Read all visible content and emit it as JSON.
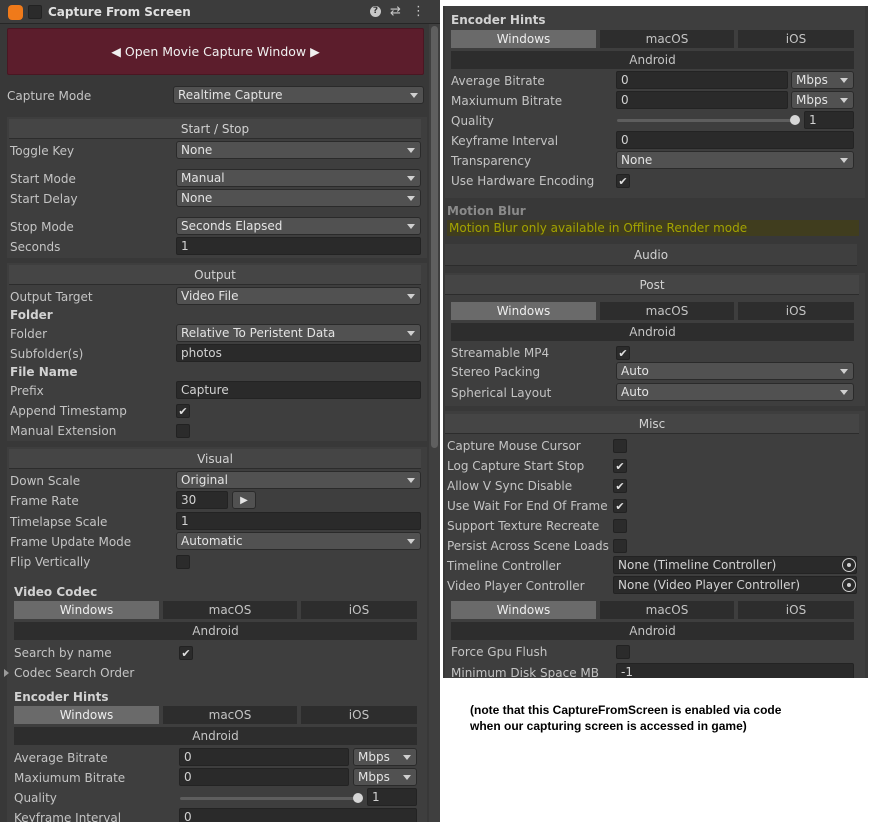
{
  "header": {
    "title": "Capture From Screen",
    "help_icon": "help-icon",
    "settings_icon": "sliders-icon",
    "more_icon": "kebab-icon"
  },
  "colors": {
    "banner": "#5c1d2c",
    "panel": "#383838",
    "active_tab": "#6a6a6a",
    "motion_blur_text": "#a3a300"
  },
  "banner": {
    "label": "◀ Open Movie Capture Window ▶"
  },
  "capture_mode": {
    "label": "Capture Mode",
    "value": "Realtime Capture"
  },
  "start_stop": {
    "header": "Start / Stop",
    "toggle_key": {
      "label": "Toggle Key",
      "value": "None"
    },
    "start_mode": {
      "label": "Start Mode",
      "value": "Manual"
    },
    "start_delay": {
      "label": "Start Delay",
      "value": "None"
    },
    "stop_mode": {
      "label": "Stop Mode",
      "value": "Seconds Elapsed"
    },
    "seconds": {
      "label": "Seconds",
      "value": "1"
    }
  },
  "output": {
    "header": "Output",
    "output_target": {
      "label": "Output Target",
      "value": "Video File"
    },
    "folder_heading": "Folder",
    "folder": {
      "label": "Folder",
      "value": "Relative To Peristent Data"
    },
    "subfolder": {
      "label": "Subfolder(s)",
      "value": "photos"
    },
    "file_name_heading": "File Name",
    "prefix": {
      "label": "Prefix",
      "value": "Capture"
    },
    "append_timestamp": {
      "label": "Append Timestamp",
      "checked": "✔"
    },
    "manual_extension": {
      "label": "Manual Extension"
    }
  },
  "visual": {
    "header": "Visual",
    "down_scale": {
      "label": "Down Scale",
      "value": "Original"
    },
    "frame_rate": {
      "label": "Frame Rate",
      "value": "30",
      "play": "▶"
    },
    "timelapse_scale": {
      "label": "Timelapse Scale",
      "value": "1"
    },
    "frame_update_mode": {
      "label": "Frame Update Mode",
      "value": "Automatic"
    },
    "flip_vertically": {
      "label": "Flip Vertically"
    }
  },
  "platform_tabs": {
    "windows": "Windows",
    "macos": "macOS",
    "ios": "iOS",
    "android": "Android"
  },
  "video_codec": {
    "heading": "Video Codec",
    "search_by_name": {
      "label": "Search by name",
      "checked": "✔"
    },
    "codec_search_order": "Codec Search Order"
  },
  "encoder_hints": {
    "heading": "Encoder Hints",
    "average_bitrate": {
      "label": "Average Bitrate",
      "value": "0",
      "unit": "Mbps"
    },
    "maximum_bitrate": {
      "label": "Maxiumum Bitrate",
      "value": "0",
      "unit": "Mbps"
    },
    "quality": {
      "label": "Quality",
      "value": "1",
      "level": 1.0
    },
    "keyframe_interval": {
      "label": "Keyframe Interval",
      "value": "0"
    },
    "transparency": {
      "label": "Transparency",
      "value": "None"
    },
    "use_hardware_encoding": {
      "label": "Use Hardware Encoding",
      "checked": "✔"
    }
  },
  "motion_blur": {
    "heading": "Motion Blur",
    "message": "Motion Blur only available in Offline Render mode"
  },
  "audio": {
    "header": "Audio"
  },
  "post": {
    "header": "Post",
    "streamable_mp4": {
      "label": "Streamable MP4",
      "checked": "✔"
    },
    "stereo_packing": {
      "label": "Stereo Packing",
      "value": "Auto"
    },
    "spherical_layout": {
      "label": "Spherical Layout",
      "value": "Auto"
    }
  },
  "misc": {
    "header": "Misc",
    "capture_mouse_cursor": {
      "label": "Capture Mouse Cursor"
    },
    "log_capture_start_stop": {
      "label": "Log Capture Start Stop",
      "checked": "✔"
    },
    "allow_vsync_disable": {
      "label": "Allow V Sync Disable",
      "checked": "✔"
    },
    "use_wait_for_end_of_frame": {
      "label": "Use Wait For End Of Frame",
      "checked": "✔"
    },
    "support_texture_recreate": {
      "label": "Support Texture Recreate"
    },
    "persist_across_scene_loads": {
      "label": "Persist Across Scene Loads"
    },
    "timeline_controller": {
      "label": "Timeline Controller",
      "value": "None (Timeline Controller)"
    },
    "video_player_controller": {
      "label": "Video Player Controller",
      "value": "None (Video Player Controller)"
    },
    "force_gpu_flush": {
      "label": "Force Gpu Flush"
    },
    "minimum_disk_space": {
      "label": "Minimum Disk Space MB",
      "value": "-1"
    }
  },
  "note": {
    "line1": "(note that this CaptureFromScreen is enabled via code",
    "line2": "when our capturing screen is accessed in game)"
  }
}
